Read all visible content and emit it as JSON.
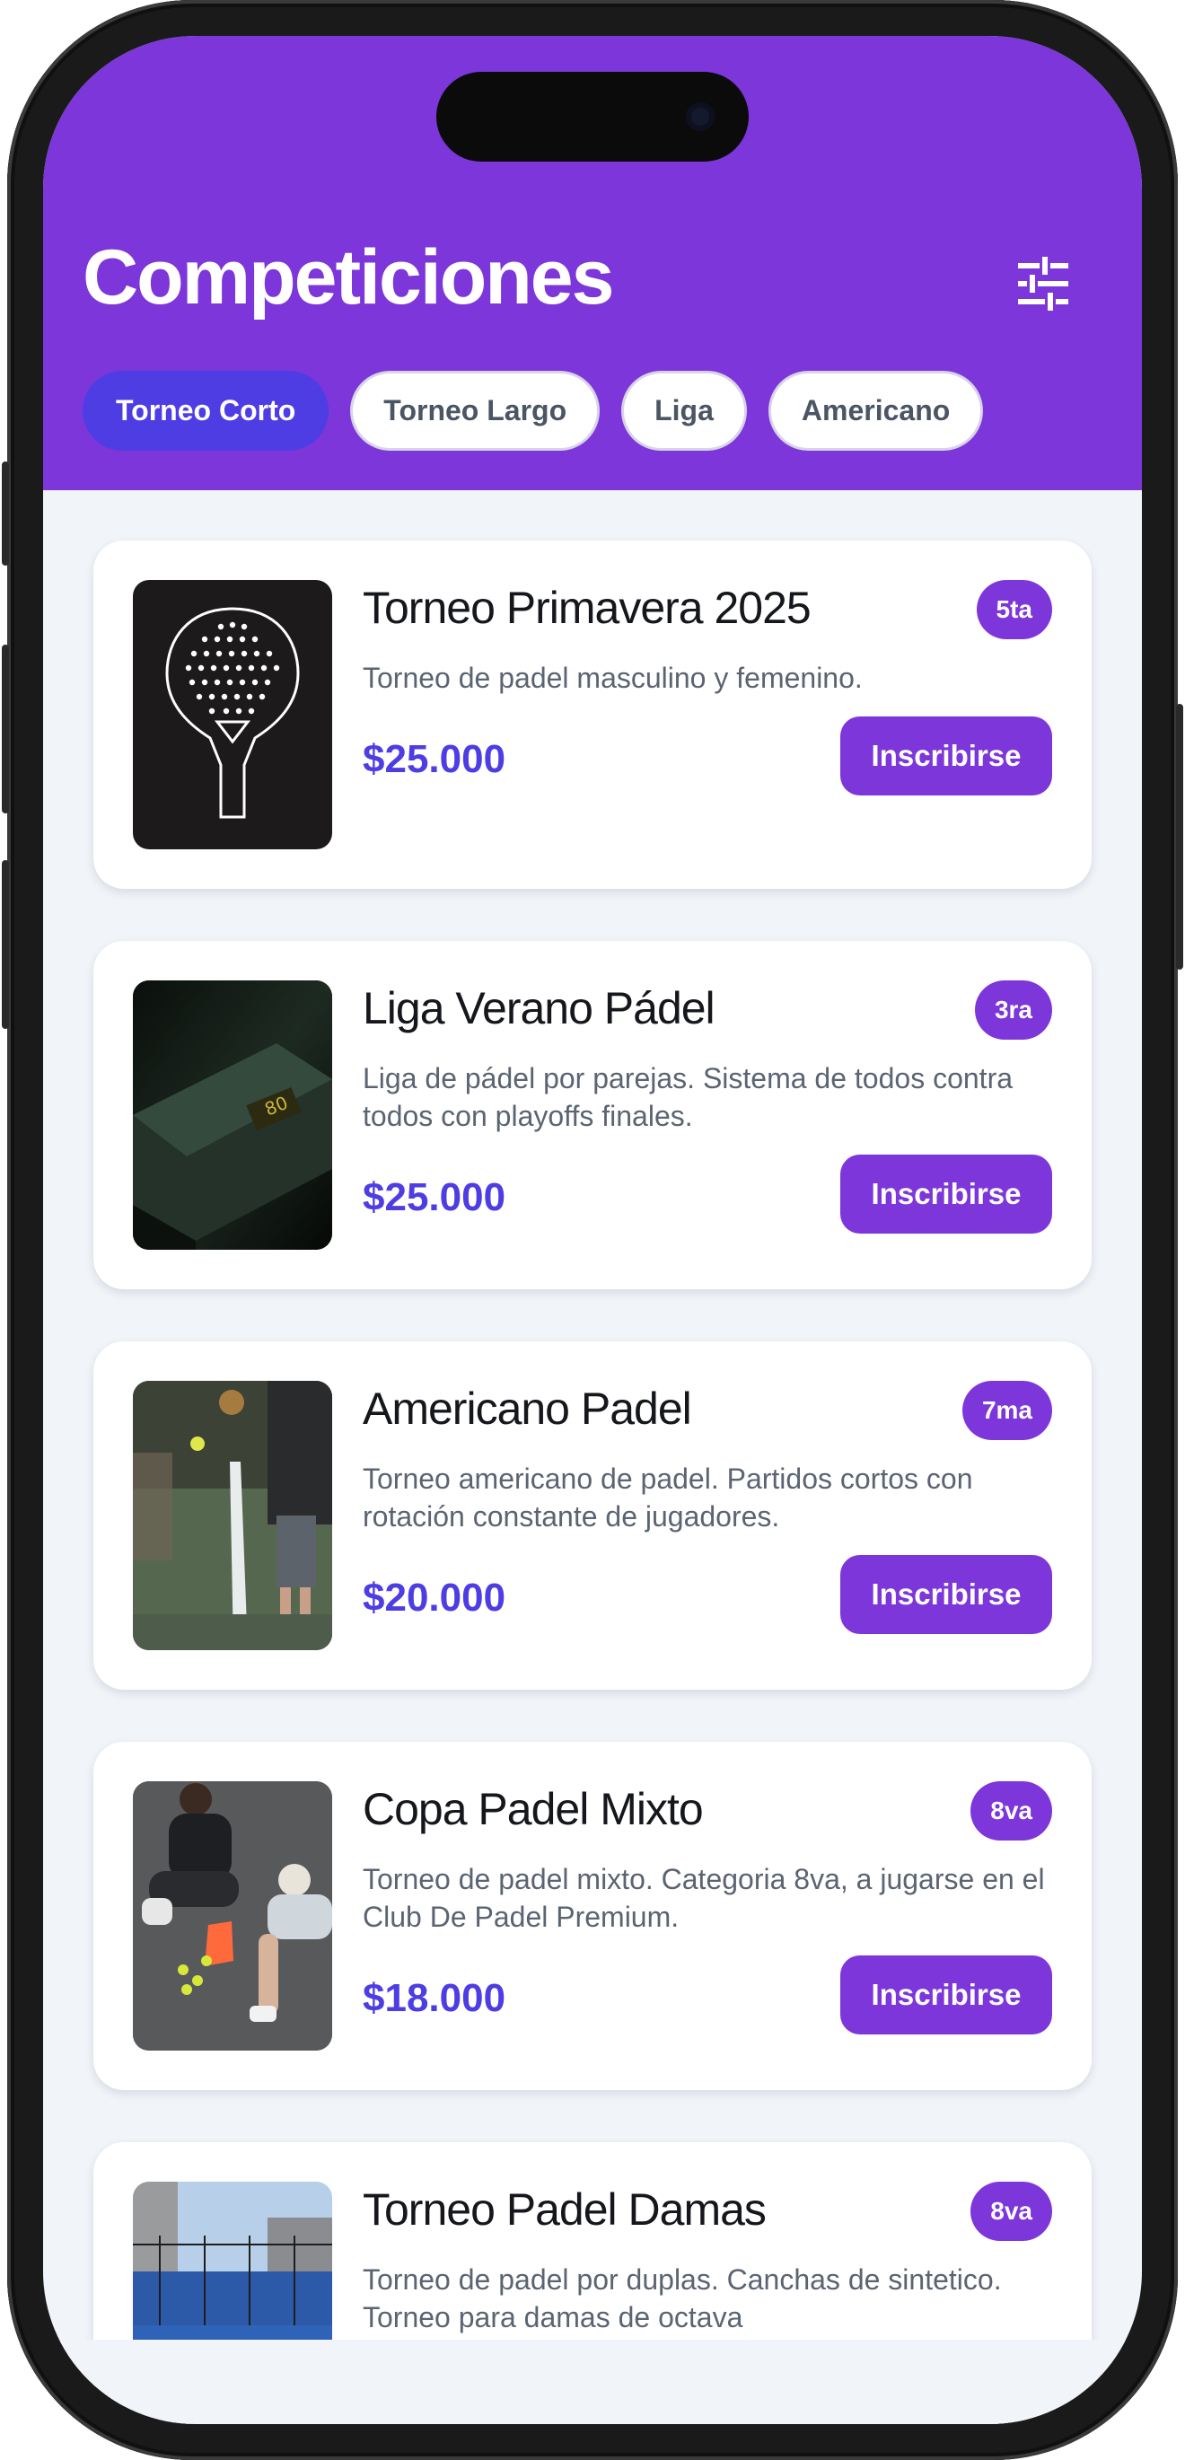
{
  "header": {
    "title": "Competiciones",
    "filter_icon": "sliders-icon"
  },
  "tabs": [
    {
      "label": "Torneo Corto",
      "active": true
    },
    {
      "label": "Torneo Largo",
      "active": false
    },
    {
      "label": "Liga",
      "active": false
    },
    {
      "label": "Americano",
      "active": false
    }
  ],
  "competitions": [
    {
      "title": "Torneo Primavera 2025",
      "category": "5ta",
      "description": "Torneo de padel masculino y femenino.",
      "price": "$25.000",
      "button": "Inscribirse"
    },
    {
      "title": "Liga Verano Pádel",
      "category": "3ra",
      "description": "Liga de pádel por parejas. Sistema de todos contra todos con playoffs finales.",
      "price": "$25.000",
      "button": "Inscribirse"
    },
    {
      "title": "Americano Padel",
      "category": "7ma",
      "description": "Torneo americano de padel. Partidos cortos con rotación constante de jugadores.",
      "price": "$20.000",
      "button": "Inscribirse"
    },
    {
      "title": "Copa Padel Mixto",
      "category": "8va",
      "description": "Torneo de padel mixto. Categoria 8va, a jugarse en el Club De Padel Premium.",
      "price": "$18.000",
      "button": "Inscribirse"
    },
    {
      "title": "Torneo Padel Damas",
      "category": "8va",
      "description": "Torneo de padel por duplas. Canchas de sintetico. Torneo para damas de octava",
      "price": "",
      "button": ""
    }
  ],
  "colors": {
    "header_bg": "#7d36d9",
    "accent": "#4e3de3",
    "badge_bg": "#7d36d9",
    "page_bg": "#f1f4f8"
  }
}
